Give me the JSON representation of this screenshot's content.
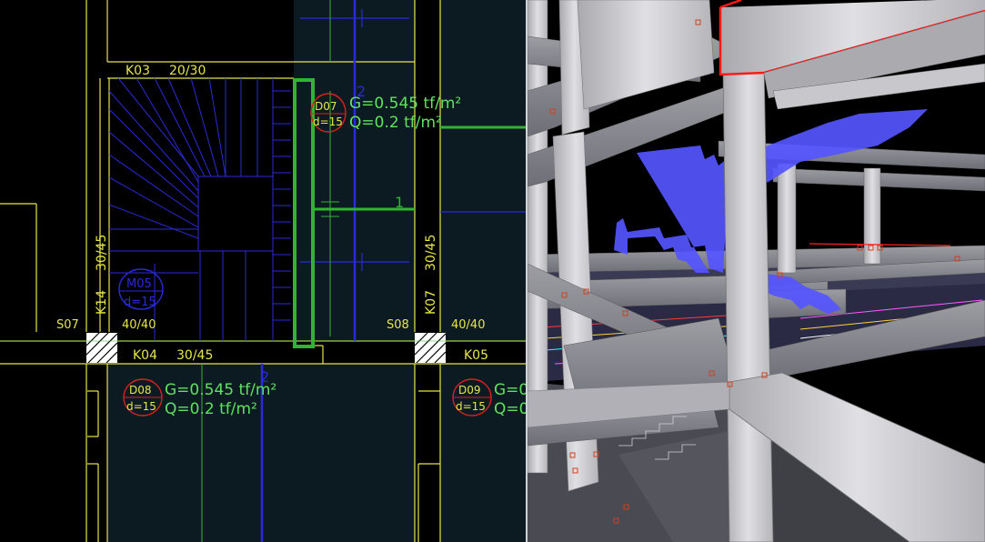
{
  "plan": {
    "beams": {
      "k03": {
        "name": "K03",
        "size": "20/30"
      },
      "k04": {
        "name": "K04",
        "size": "30/45"
      },
      "k05": {
        "name": "K05"
      },
      "k14": {
        "name": "K14",
        "size": "30/45"
      },
      "k07": {
        "name": "K07",
        "size": "30/45"
      }
    },
    "columns": {
      "s07": {
        "name": "S07",
        "size": "40/40"
      },
      "s08": {
        "name": "S08",
        "size": "40/40"
      }
    },
    "slabs": {
      "d07": {
        "name": "D07",
        "thickness": "d=15",
        "g": "G=0.545 tf/m²",
        "q": "Q=0.2 tf/m²"
      },
      "d08": {
        "name": "D08",
        "thickness": "d=15",
        "g": "G=0.545 tf/m²",
        "q": "Q=0.2 tf/m²"
      },
      "d09": {
        "name": "D09",
        "thickness": "d=15",
        "g": "G=0",
        "q": "Q=0"
      },
      "m05": {
        "name": "M05",
        "thickness": "d=15"
      }
    },
    "markers": {
      "one": "1",
      "two": "2"
    },
    "colors": {
      "background": "#000000",
      "slab_fill": "#0c1b22",
      "beam_line": "#e6e64a",
      "stair_line": "#2a2ad8",
      "load_text": "#5fe35f",
      "selection": "#2fb52f",
      "slab_tag": "#d92020"
    }
  },
  "view3d": {
    "colors": {
      "background": "#000000",
      "concrete": "#d4d4d8",
      "stair": "#5555ff",
      "selected_beam": "#ff1a1a",
      "node_marker": "#d04020"
    }
  }
}
